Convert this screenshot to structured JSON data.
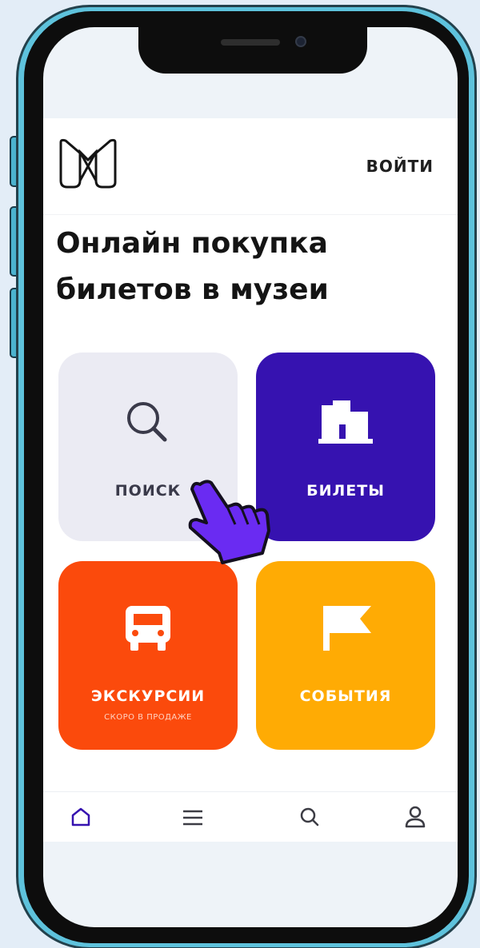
{
  "header": {
    "login_label": "ВОЙТИ"
  },
  "main": {
    "title": "Онлайн покупка\nбилетов в музеи",
    "tiles": [
      {
        "label": "ПОИСК",
        "icon": "search-icon",
        "color": "#ebebf3",
        "text_color": "#3a3a4a"
      },
      {
        "label": "БИЛЕТЫ",
        "icon": "museum-buildings-icon",
        "color": "#3612b0",
        "text_color": "#ffffff"
      },
      {
        "label": "ЭКСКУРСИИ",
        "sublabel": "СКОРО В ПРОДАЖЕ",
        "icon": "bus-icon",
        "color": "#fb4a0c",
        "text_color": "#ffffff"
      },
      {
        "label": "СОБЫТИЯ",
        "icon": "flag-icon",
        "color": "#ffab04",
        "text_color": "#ffffff"
      }
    ]
  },
  "bottom_nav": {
    "items": [
      {
        "icon": "home-icon",
        "active": true
      },
      {
        "icon": "menu-icon",
        "active": false
      },
      {
        "icon": "search-icon",
        "active": false
      },
      {
        "icon": "profile-icon",
        "active": false
      }
    ],
    "active_color": "#3612b0",
    "inactive_color": "#3c3c44"
  },
  "colors": {
    "frame": "#5ec2dc",
    "cursor": "#6a2bf2"
  }
}
